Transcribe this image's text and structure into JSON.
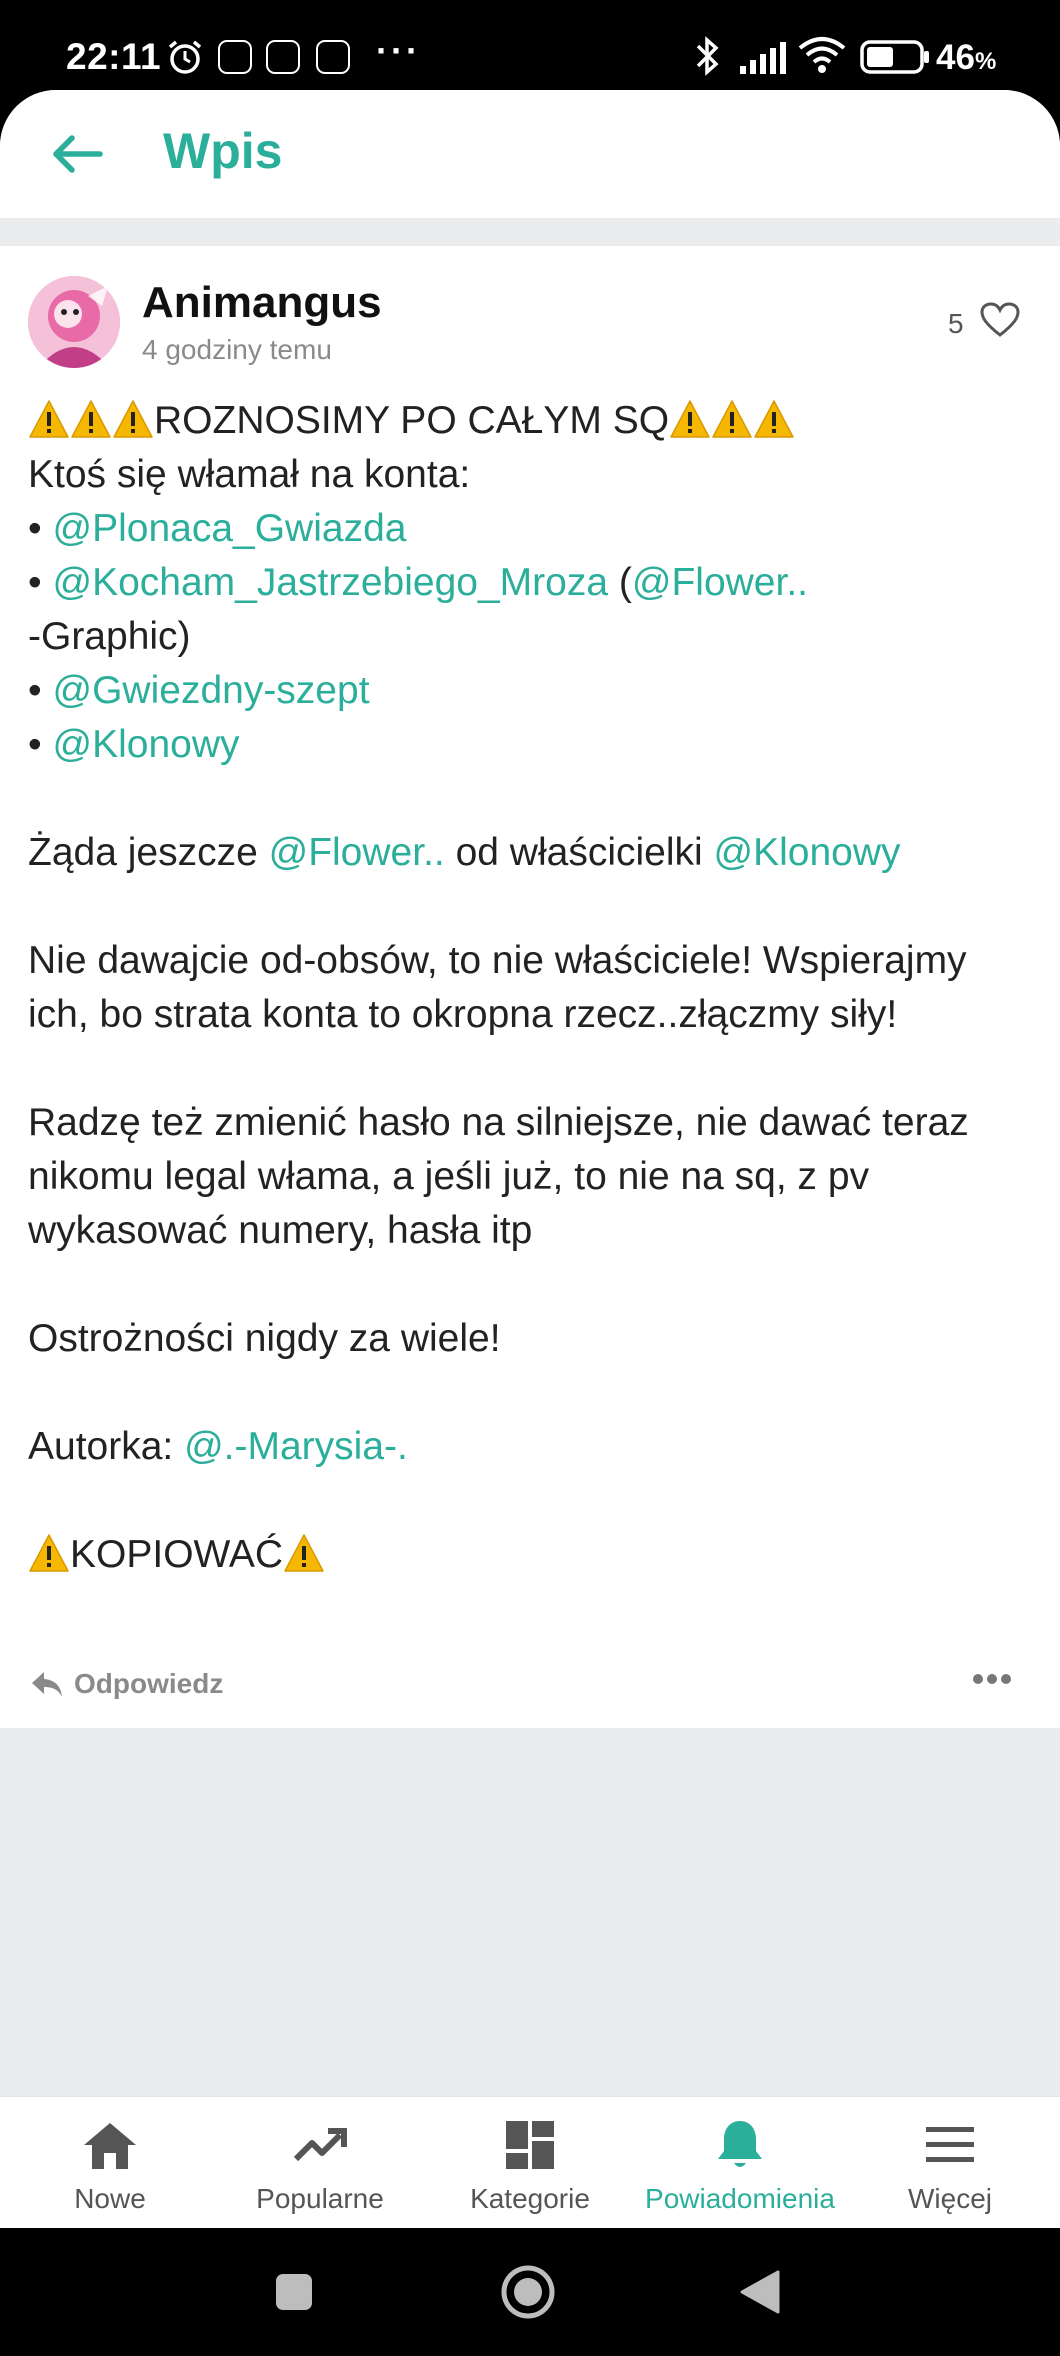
{
  "status_bar": {
    "time": "22:11",
    "battery": "46",
    "battery_unit": "%",
    "dots": "···"
  },
  "header": {
    "title": "Wpis",
    "back_icon": "arrow-left-icon"
  },
  "post": {
    "author": "Animangus",
    "time_ago": "4 godziny temu",
    "likes": "5",
    "headline_text": "ROZNOSIMY PO CAŁYM SQ",
    "line_hacked": "Ktoś się włamał na konta:",
    "bullet": "•",
    "mentions": {
      "m1": "@Plonaca_Gwiazda",
      "m2": "@Kocham_Jastrzebiego_Mroza",
      "m2_open": "(",
      "m2_sub": "@Flower..",
      "m2_close": "-Graphic)",
      "m3": "@Gwiezdny-szept",
      "m4": "@Klonowy"
    },
    "demand_pre": "Żąda jeszcze ",
    "demand_mention1": "@Flower..",
    "demand_mid": " od właścicielki ",
    "demand_mention2": "@Klonowy",
    "para_dont_give": "Nie dawajcie od-obsów, to nie właściciele! Wspierajmy ich, bo strata konta to okropna rzecz..złączmy siły!",
    "para_advice": "Radzę też zmienić hasło na silniejsze, nie dawać teraz nikomu legal włama, a jeśli już, to nie na sq, z pv wykasować numery, hasła itp",
    "para_caution": "Ostrożności nigdy za wiele!",
    "author_credit_label": "Autorka: ",
    "author_credit_mention": "@.-Marysia-.",
    "copy_text": "KOPIOWAĆ",
    "reply_label": "Odpowiedz"
  },
  "bottom_nav": {
    "items": [
      {
        "label": "Nowe",
        "icon": "home-icon"
      },
      {
        "label": "Popularne",
        "icon": "trending-icon"
      },
      {
        "label": "Kategorie",
        "icon": "dashboard-icon"
      },
      {
        "label": "Powiadomienia",
        "icon": "bell-icon"
      },
      {
        "label": "Więcej",
        "icon": "menu-icon"
      }
    ],
    "active_index": 3
  },
  "system_nav": {
    "icons": [
      "recent-apps-icon",
      "home-circle-icon",
      "back-triangle-icon"
    ]
  },
  "colors": {
    "accent": "#2bae9a",
    "text": "#222222",
    "muted": "#8a8a8a",
    "background_gray": "#eaeced",
    "warning": "#f5b700"
  }
}
